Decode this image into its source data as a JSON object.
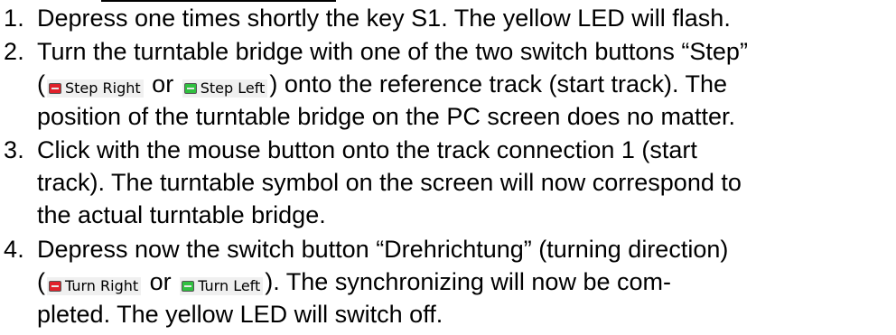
{
  "steps": [
    {
      "number": "1.",
      "lines": [
        "Depress one times shortly the key S1. The yellow LED will flash."
      ]
    },
    {
      "number": "2.",
      "line1": "Turn the turntable bridge with one of the two switch buttons “Step”",
      "line2_open": "(",
      "btn_a": "Step Right",
      "or": "or",
      "btn_b": "Step Left",
      "line2_rest": ") onto the reference track (start track). The",
      "line3": "position of the turntable bridge on the PC screen does no matter."
    },
    {
      "number": "3.",
      "lines": [
        "Click with the mouse button onto the track connection 1 (start",
        "track). The turntable symbol on the screen will now correspond to",
        "the actual turntable bridge."
      ]
    },
    {
      "number": "4.",
      "line1": "Depress now the switch button “Drehrichtung” (turning direction)",
      "line2_open": "(",
      "btn_a": "Turn Right",
      "or": "or",
      "btn_b": "Turn Left",
      "line2_rest": "). The synchronizing will now be com-",
      "line3": "pleted. The yellow LED will switch off."
    }
  ],
  "colors": {
    "button_right_swatch": "#e0202a",
    "button_left_swatch": "#30c040",
    "button_bg": "#f0f0f0"
  },
  "icons": {
    "right": "red-square-button-icon",
    "left": "green-square-button-icon"
  }
}
